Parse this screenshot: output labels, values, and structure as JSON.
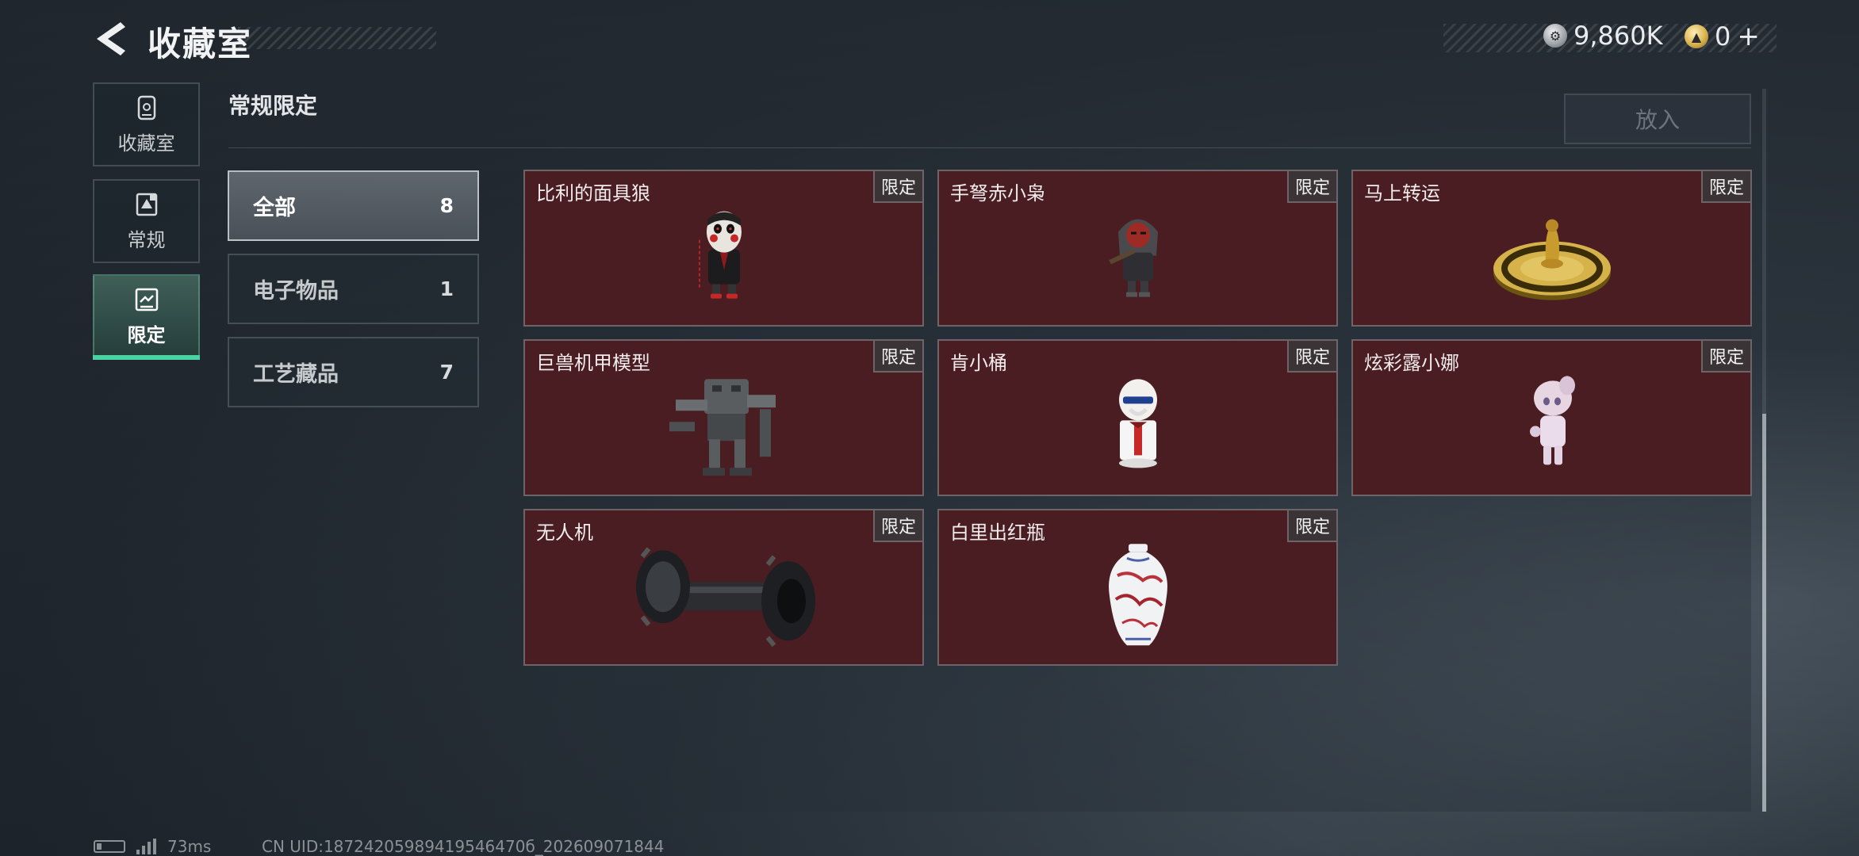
{
  "header": {
    "title": "收藏室",
    "currency": [
      {
        "icon": "silver-coin-icon",
        "value": "9,860K"
      },
      {
        "icon": "gold-coin-icon",
        "value": "0"
      }
    ],
    "plus_label": "+"
  },
  "nav": [
    {
      "label": "收藏室",
      "icon": "collection-room-icon"
    },
    {
      "label": "常规",
      "icon": "regular-icon"
    },
    {
      "label": "限定",
      "icon": "limited-icon",
      "active": true
    }
  ],
  "section": {
    "title": "常规限定",
    "place_button": "放入"
  },
  "filters": [
    {
      "label": "全部",
      "count": "8",
      "active": true
    },
    {
      "label": "电子物品",
      "count": "1"
    },
    {
      "label": "工艺藏品",
      "count": "7"
    }
  ],
  "cards": [
    {
      "name": "比利的面具狼",
      "badge": "限定"
    },
    {
      "name": "手弩赤小枭",
      "badge": "限定"
    },
    {
      "name": "马上转运",
      "badge": "限定"
    },
    {
      "name": "巨兽机甲模型",
      "badge": "限定"
    },
    {
      "name": "肯小桶",
      "badge": "限定"
    },
    {
      "name": "炫彩露小娜",
      "badge": "限定"
    },
    {
      "name": "无人机",
      "badge": "限定"
    },
    {
      "name": "白里出红瓶",
      "badge": "限定"
    }
  ],
  "footer": {
    "ping": "73ms",
    "uid": "CN UID:18724205989419546470б_202609071844"
  },
  "colors": {
    "accent": "#48d3a1",
    "card_bg": "#4a1d22",
    "card_border": "#6e6468"
  }
}
